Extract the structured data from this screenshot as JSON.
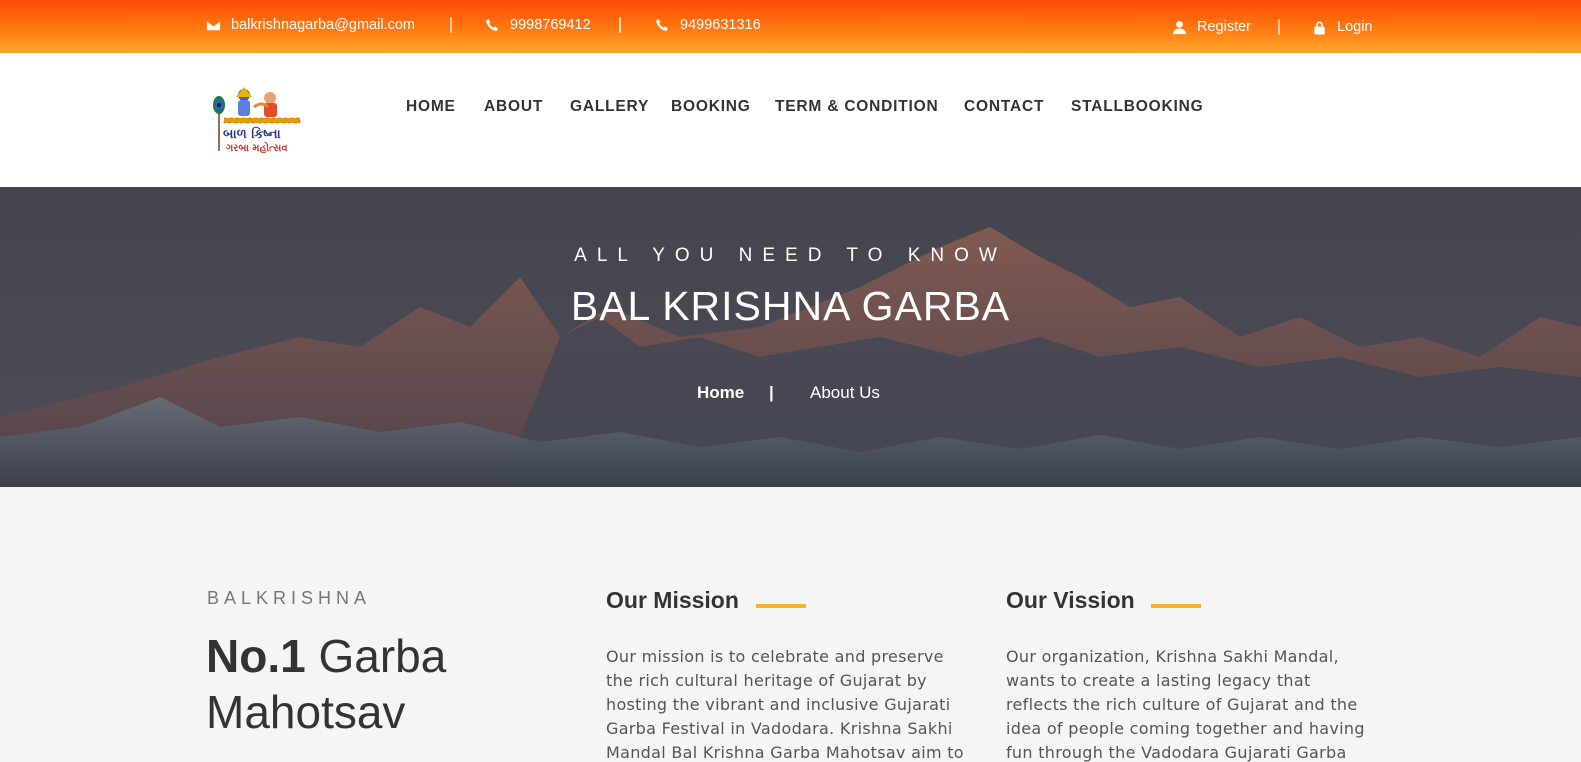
{
  "topbar": {
    "email": "balkrishnagarba@gmail.com",
    "separator": "|",
    "phone1": "9998769412",
    "phone2": "9499631316",
    "register_label": "Register",
    "login_label": "Login",
    "colors": {
      "gradient_start": "#ff4a05",
      "gradient_end": "#ffa82c"
    }
  },
  "logo": {
    "line1": "બાળ કિષ્ના",
    "line2": "ગરબા મહોત્સવ"
  },
  "nav": {
    "items": [
      {
        "label": "HOME"
      },
      {
        "label": "ABOUT"
      },
      {
        "label": "GALLERY"
      },
      {
        "label": "BOOKING"
      },
      {
        "label": "TERM & CONDITION"
      },
      {
        "label": "CONTACT"
      },
      {
        "label": "STALLBOOKING"
      }
    ]
  },
  "hero": {
    "kicker": "ALL YOU NEED TO KNOW",
    "title": "BAL KRISHNA GARBA",
    "breadcrumb": {
      "home": "Home",
      "separator": "|",
      "current": "About Us"
    }
  },
  "about": {
    "kicker": "BALKRISHNA",
    "headline_bold": "No.1",
    "headline_rest": "Garba Mahotsav"
  },
  "mission": {
    "title": "Our Mission",
    "text": "Our mission is to celebrate and preserve the rich cultural heritage of Gujarat by hosting the vibrant and inclusive Gujarati Garba Festival in Vadodara. Krishna Sakhi Mandal Bal Krishna Garba Mahotsav aim to"
  },
  "vision": {
    "title": "Our Vission",
    "text": "Our organization, Krishna Sakhi Mandal, wants to create a lasting legacy that reflects the rich culture of Gujarat and the idea of people coming together and having fun through the Vadodara Gujarati Garba"
  },
  "accent_color": "#f5b32a"
}
